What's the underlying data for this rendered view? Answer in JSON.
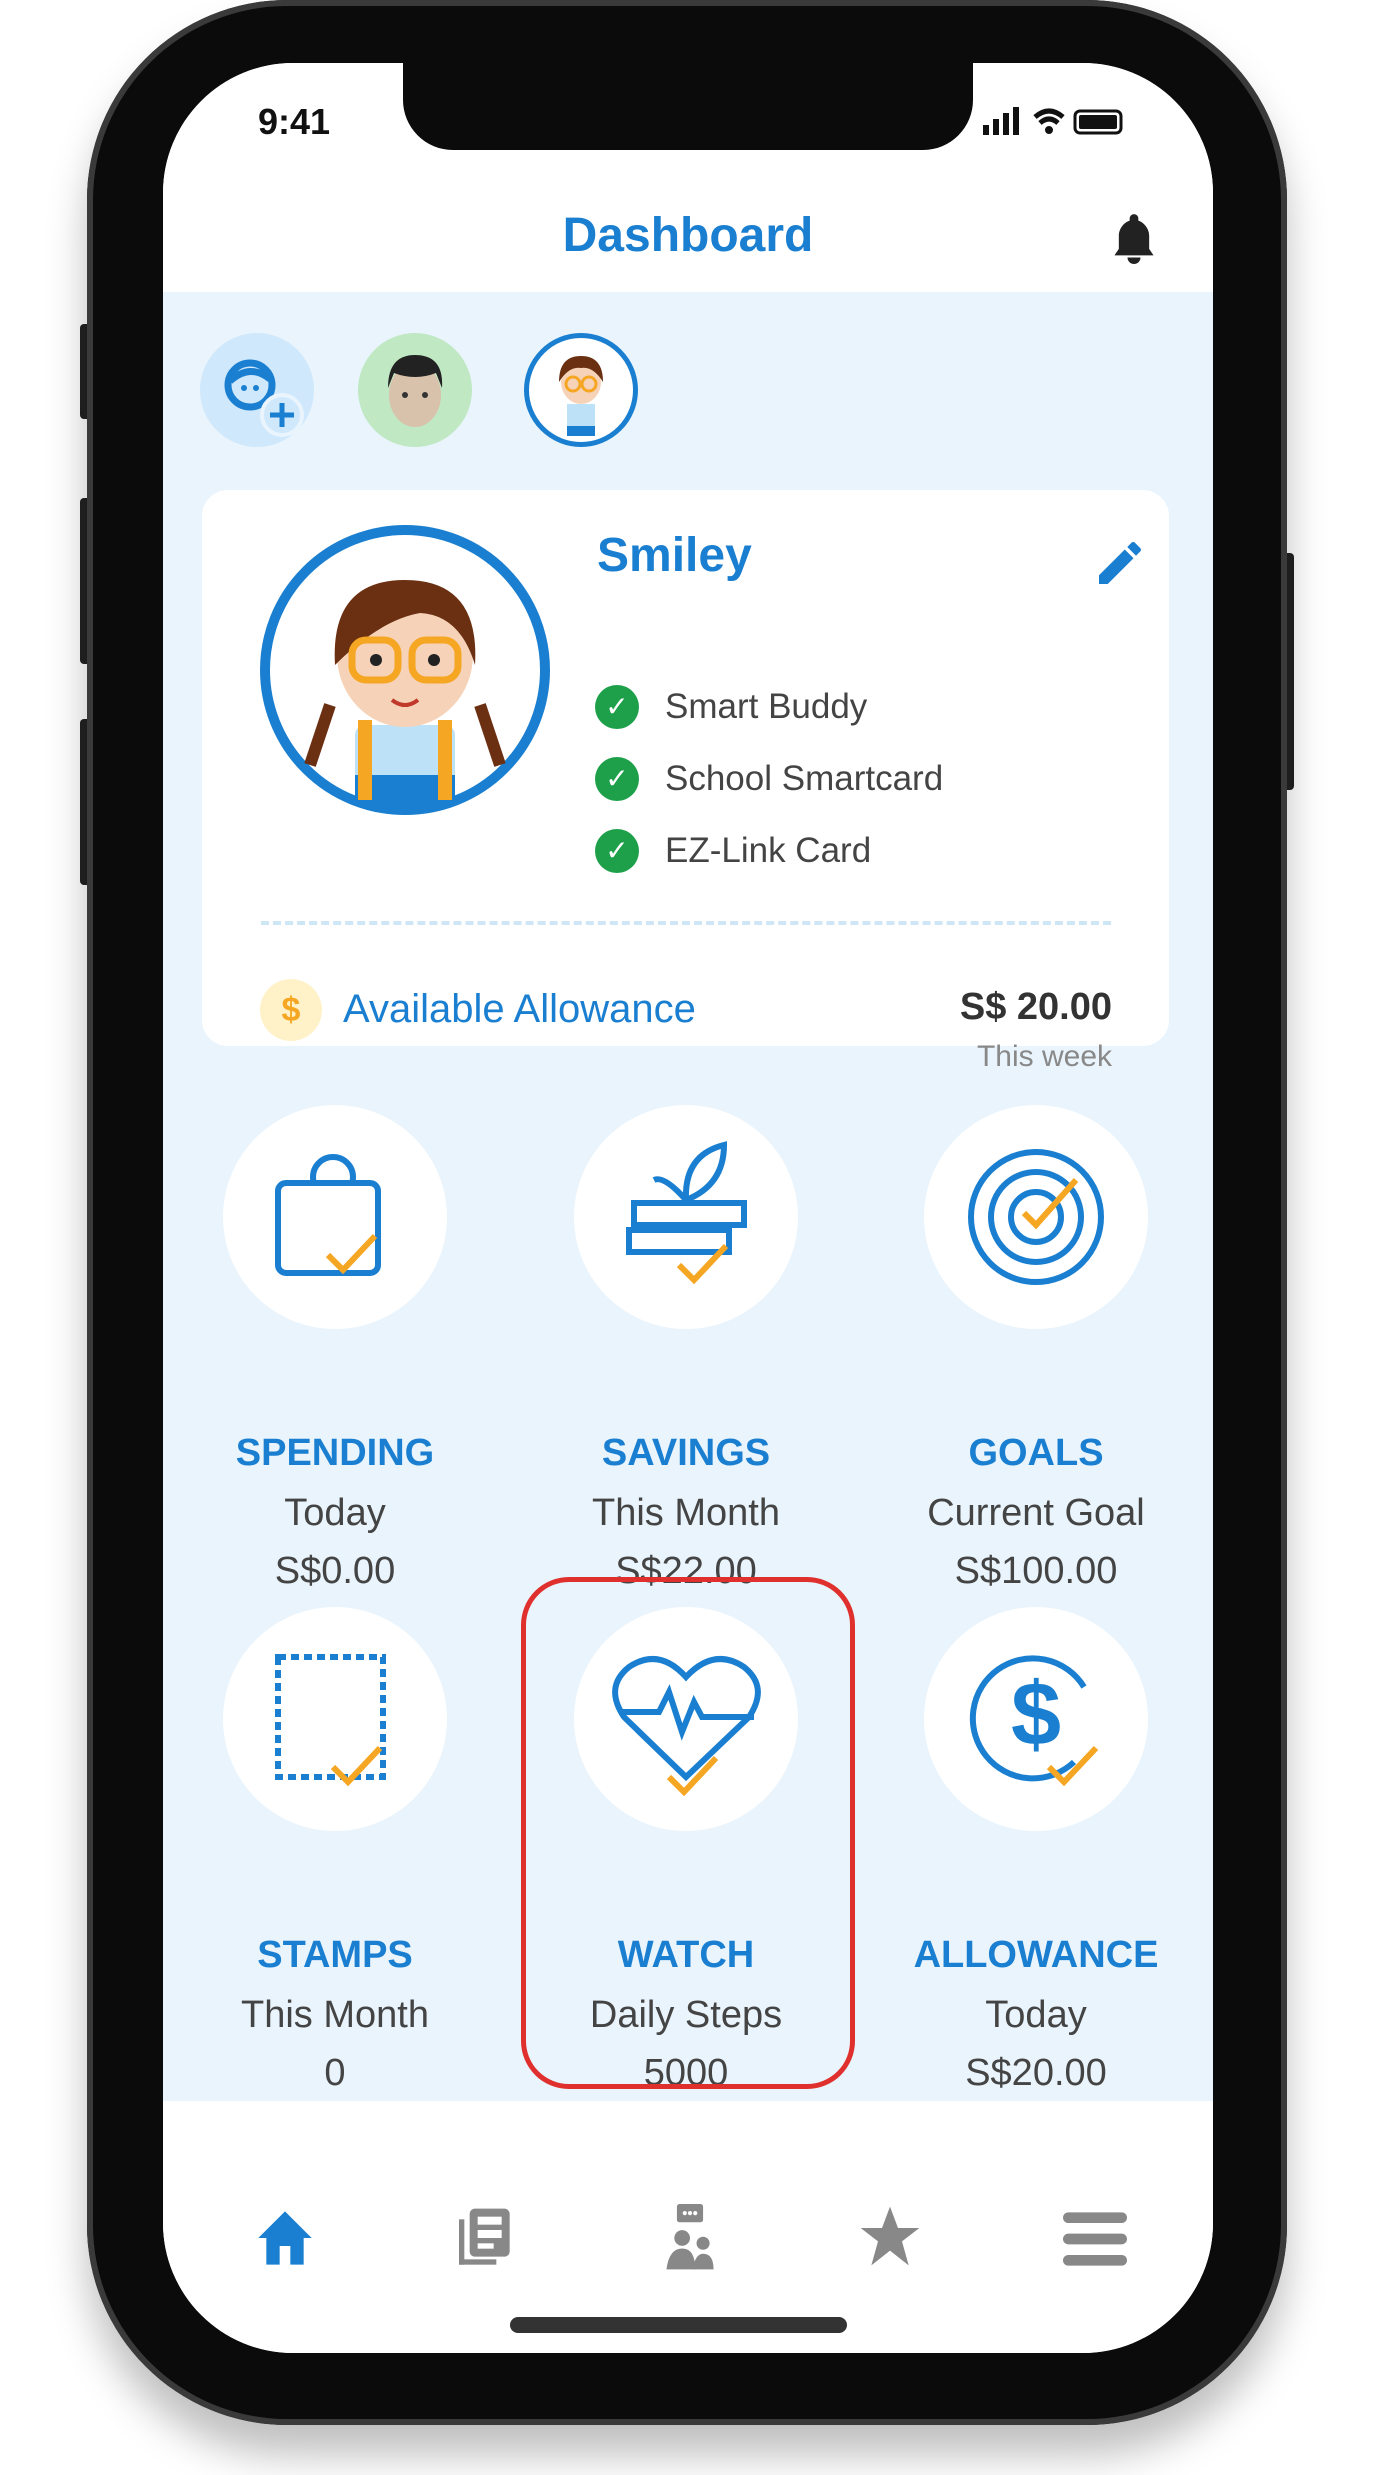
{
  "status_bar": {
    "time": "9:41"
  },
  "header": {
    "title": "Dashboard",
    "bell_icon": "bell-icon"
  },
  "profiles": [
    {
      "name": "add-child",
      "icon": "add-user-icon"
    },
    {
      "name": "boy"
    },
    {
      "name": "girl",
      "selected": true
    }
  ],
  "profile_card": {
    "name": "Smiley",
    "edit_icon": "pencil-icon",
    "linked": [
      {
        "label": "Smart Buddy"
      },
      {
        "label": "School Smartcard"
      },
      {
        "label": "EZ-Link Card"
      }
    ],
    "allowance_label": "Available Allowance",
    "allowance_amount": "S$ 20.00",
    "allowance_period": "This week"
  },
  "tiles": [
    {
      "title": "SPENDING",
      "subtitle": "Today",
      "value": "S$0.00",
      "icon": "wallet-icon"
    },
    {
      "title": "SAVINGS",
      "subtitle": "This Month",
      "value": "S$22.00",
      "icon": "plant-icon"
    },
    {
      "title": "GOALS",
      "subtitle": "Current Goal",
      "value": "S$100.00",
      "icon": "target-icon"
    },
    {
      "title": "STAMPS",
      "subtitle": "This Month",
      "value": "0",
      "icon": "stamp-icon"
    },
    {
      "title": "WATCH",
      "subtitle": "Daily Steps",
      "value": "5000",
      "icon": "heart-rate-icon",
      "highlighted": true
    },
    {
      "title": "ALLOWANCE",
      "subtitle": "Today",
      "value": "S$20.00",
      "icon": "dollar-icon"
    }
  ],
  "bottom_nav": [
    {
      "icon": "home-icon",
      "active": true
    },
    {
      "icon": "news-icon"
    },
    {
      "icon": "community-icon"
    },
    {
      "icon": "star-icon"
    },
    {
      "icon": "menu-icon"
    }
  ],
  "colors": {
    "accent": "#1a7fd0",
    "background": "#e9f4fc",
    "check": "#1ea04a",
    "highlight": "#e0302e",
    "tick": "#f5a623"
  }
}
